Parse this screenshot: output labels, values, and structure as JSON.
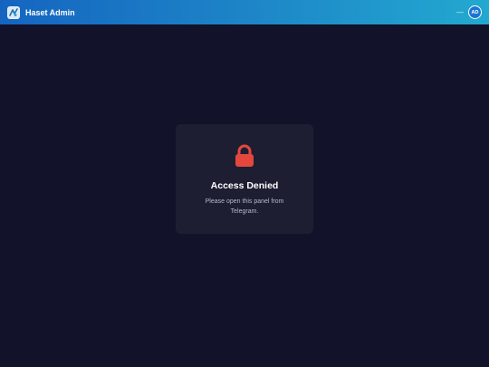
{
  "header": {
    "app_title": "Haset Admin",
    "minimize_glyph": "—",
    "avatar_initials": "AD",
    "logo_icon": "haset-logo-icon"
  },
  "access": {
    "icon": "lock-icon",
    "heading": "Access Denied",
    "message": "Please open this panel from Telegram."
  },
  "colors": {
    "header_start": "#1565c0",
    "header_end": "#22a9d0",
    "background": "#12122a",
    "card": "#1e1e33",
    "lock": "#e4473d"
  }
}
